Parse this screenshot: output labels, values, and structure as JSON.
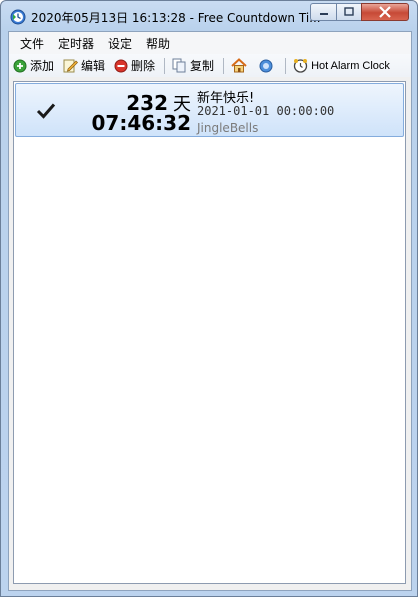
{
  "window": {
    "title": "2020年05月13日 16:13:28 - Free Countdown Ti..."
  },
  "menu": [
    "文件",
    "定时器",
    "设定",
    "帮助"
  ],
  "toolbar": {
    "add": "添加",
    "edit": "编辑",
    "delete": "删除",
    "copy": "复制",
    "hot_alarm": "Hot Alarm Clock"
  },
  "timers": [
    {
      "checked": true,
      "days": "232",
      "days_unit": "天",
      "time": "07:46:32",
      "title": "新年快乐!",
      "target": "2021-01-01 00:00:00",
      "sound": "JingleBells"
    }
  ],
  "colors": {
    "selection_top": "#eef5fd",
    "selection_bottom": "#cfe3fa",
    "add_green": "#3aa33a",
    "delete_red": "#d9342b",
    "close_red": "#c74a37"
  },
  "icons": {
    "app": "countdown-clock-icon",
    "add": "plus-circle-icon",
    "edit": "pencil-note-icon",
    "delete": "minus-circle-icon",
    "copy": "copy-document-icon",
    "home": "home-icon",
    "help": "help-icon",
    "hot_alarm": "alarm-clock-icon",
    "check": "check-icon"
  }
}
